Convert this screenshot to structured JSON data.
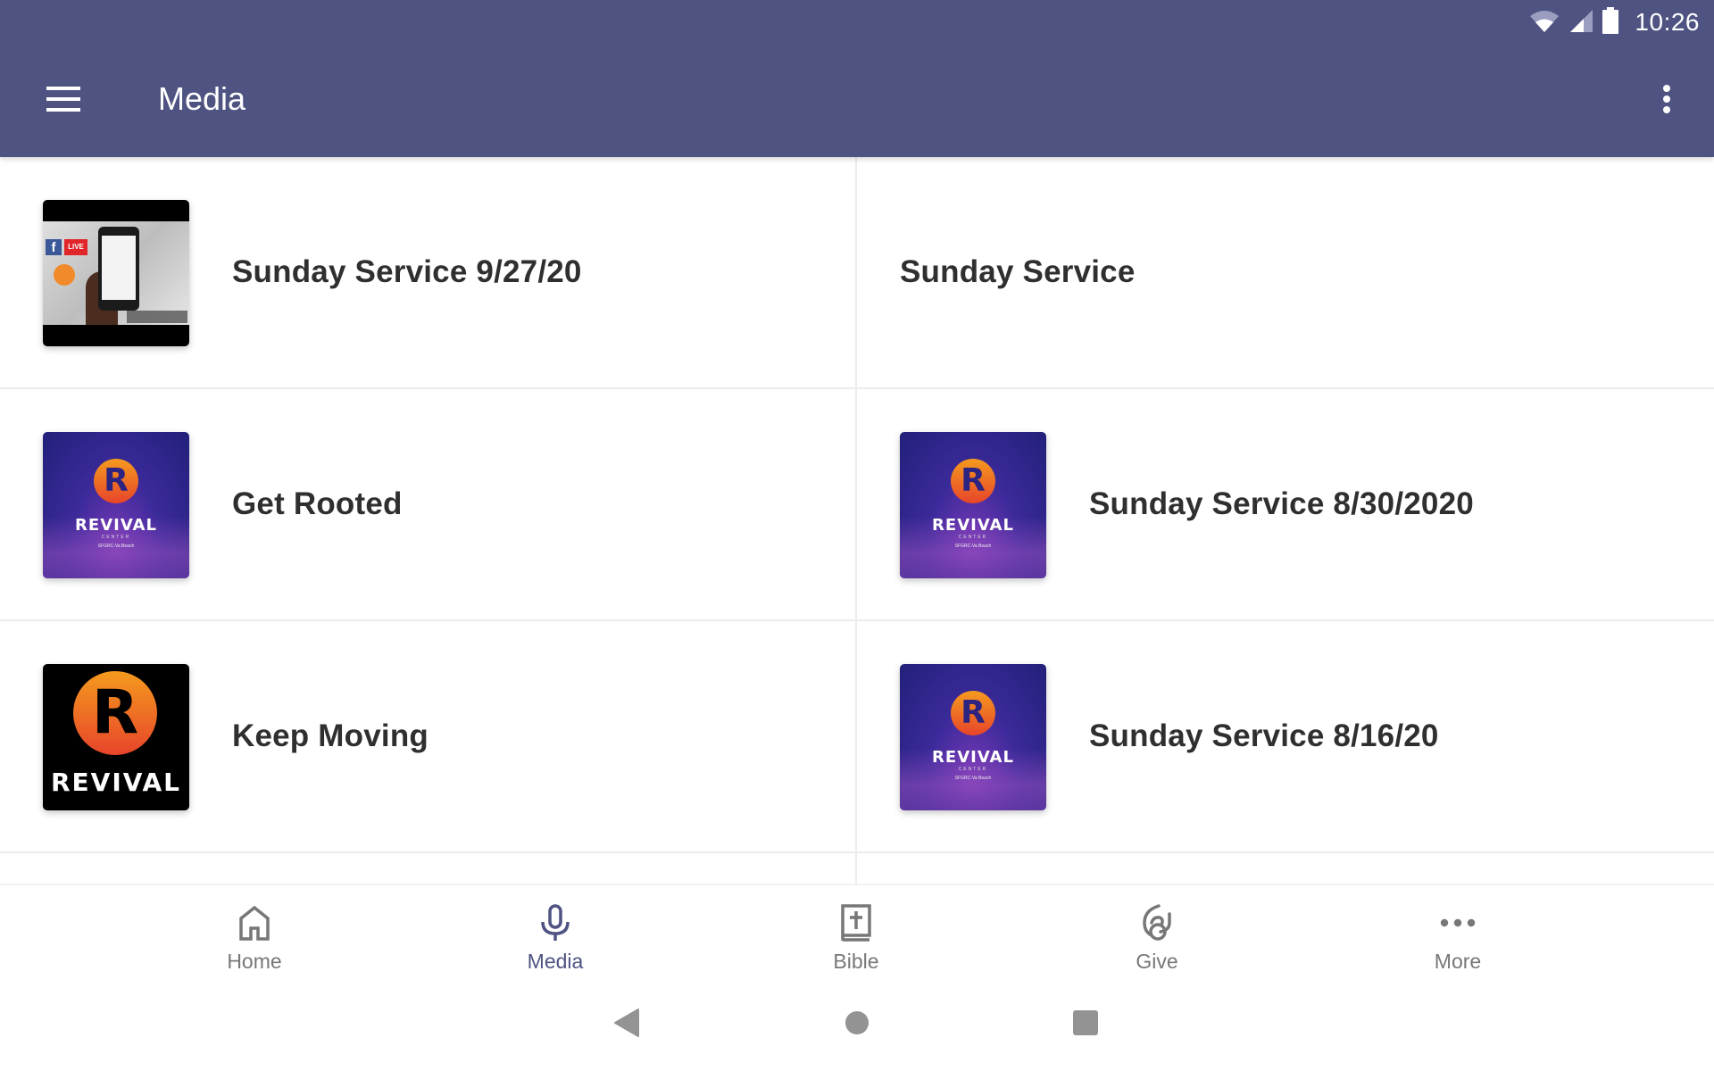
{
  "status_bar": {
    "time": "10:26",
    "icons": [
      "wifi-icon",
      "cell-signal-icon",
      "battery-icon"
    ]
  },
  "app_bar": {
    "title": "Media",
    "menu_icon": "hamburger-menu-icon",
    "overflow_icon": "more-vertical-icon"
  },
  "colors": {
    "primary": "#4f5382",
    "title_text": "#2f2f2f",
    "nav_inactive": "#777777",
    "nav_active": "#4f5382",
    "divider": "#ececec"
  },
  "media_items": [
    {
      "title": "Sunday Service 9/27/20",
      "thumbnail": "facebook-live-thumbnail"
    },
    {
      "title": "Sunday Service",
      "thumbnail": null
    },
    {
      "title": "Get Rooted",
      "thumbnail": "revival-center-crowd-thumbnail",
      "thumbnail_text": {
        "word": "REVIVAL",
        "sub": "CENTER",
        "sub2": "SFGRC-Va Beach"
      }
    },
    {
      "title": "Sunday Service 8/30/2020",
      "thumbnail": "revival-center-crowd-thumbnail",
      "thumbnail_text": {
        "word": "REVIVAL",
        "sub": "CENTER",
        "sub2": "SFGRC-Va Beach"
      }
    },
    {
      "title": "Keep Moving",
      "thumbnail": "revival-logo-black-thumbnail",
      "thumbnail_text": {
        "word": "REVIVAL"
      }
    },
    {
      "title": "Sunday Service 8/16/20",
      "thumbnail": "revival-center-crowd-thumbnail",
      "thumbnail_text": {
        "word": "REVIVAL",
        "sub": "CENTER",
        "sub2": "SFGRC-Va Beach"
      }
    }
  ],
  "thumb_live_text": {
    "fb": "f",
    "live": "LIVE"
  },
  "thumb_r_letter": "R",
  "bottom_nav": {
    "active": "Media",
    "items": [
      {
        "label": "Home",
        "icon": "home-icon"
      },
      {
        "label": "Media",
        "icon": "microphone-icon"
      },
      {
        "label": "Bible",
        "icon": "bible-icon"
      },
      {
        "label": "Give",
        "icon": "give-icon"
      },
      {
        "label": "More",
        "icon": "more-horizontal-icon"
      }
    ]
  },
  "system_nav": {
    "buttons": [
      "back-icon",
      "home-circle-icon",
      "recents-icon"
    ]
  }
}
